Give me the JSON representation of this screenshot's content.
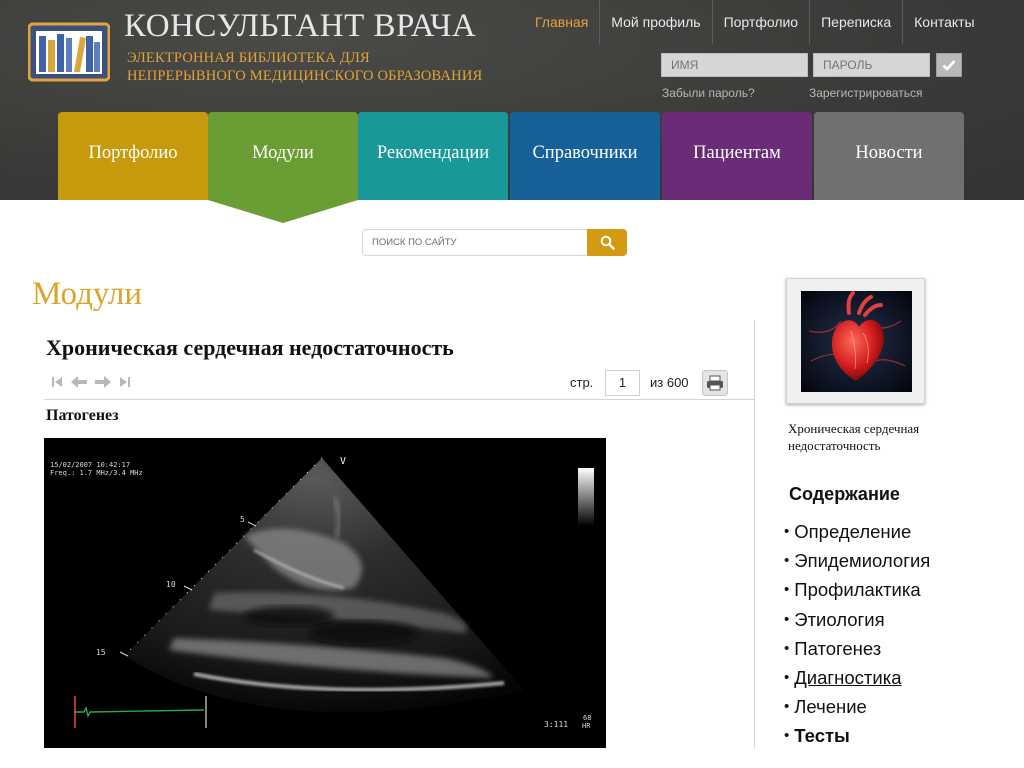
{
  "header": {
    "site_title": "КОНСУЛЬТАНТ ВРАЧА",
    "subtitle_line1": "ЭЛЕКТРОННАЯ БИБЛИОТЕКА ДЛЯ",
    "subtitle_line2": "НЕПРЕРЫВНОГО МЕДИЦИНСКОГО ОБРАЗОВАНИЯ",
    "logo_icon": "bookshelf-icon",
    "top_nav": [
      "Главная",
      "Мой профиль",
      "Портфолио",
      "Переписка",
      "Контакты"
    ],
    "active_top_nav": "Главная",
    "login": {
      "name_placeholder": "ИМЯ",
      "password_placeholder": "ПАРОЛЬ",
      "submit_icon": "checkmark-icon",
      "forgot_password": "Забыли пароль?",
      "register": "Зарегистрироваться"
    }
  },
  "main_tabs": [
    {
      "label": "Портфолио",
      "color": "#c79a0e"
    },
    {
      "label": "Модули",
      "color": "#6a9d34",
      "active": true
    },
    {
      "label": "Рекомендации",
      "color": "#19989a"
    },
    {
      "label": "Справочники",
      "color": "#16619a"
    },
    {
      "label": "Пациентам",
      "color": "#6a2c77"
    },
    {
      "label": "Новости",
      "color": "#707070"
    }
  ],
  "search": {
    "placeholder": "ПОИСК ПО САЙТУ",
    "button_icon": "search-icon",
    "button_color": "#d49a12"
  },
  "main": {
    "section_heading": "Модули",
    "article_title": "Хроническая сердечная недостаточность",
    "pager": {
      "page_label": "стр.",
      "current_page": "1",
      "total_label": "из 600",
      "nav_icons": [
        "first-page-icon",
        "prev-page-icon",
        "next-page-icon",
        "last-page-icon"
      ],
      "print_icon": "printer-icon"
    },
    "subsection_heading": "Патогенез",
    "image": {
      "kind": "echocardiogram",
      "overlay_line1": "15/02/2007 10:42:17",
      "overlay_line2": "Freq.: 1.7 MHz/3.4 MHz",
      "marker_v": "V",
      "depth_markers": [
        "5",
        "10",
        "15"
      ],
      "frame_counter": "3:111",
      "heart_rate_value": "68",
      "heart_rate_label": "HR"
    }
  },
  "sidebar": {
    "thumbnail_icon": "anatomical-heart-image",
    "module_caption": "Хроническая сердечная недостаточность",
    "contents_heading": "Содержание",
    "contents": [
      {
        "label": "Определение",
        "style": "normal"
      },
      {
        "label": "Эпидемиология",
        "style": "normal"
      },
      {
        "label": "Профилактика",
        "style": "normal"
      },
      {
        "label": "Этиология",
        "style": "normal"
      },
      {
        "label": "Патогенез",
        "style": "normal"
      },
      {
        "label": "Диагностика",
        "style": "link"
      },
      {
        "label": "Лечение",
        "style": "normal"
      },
      {
        "label": "Тесты",
        "style": "bold"
      }
    ]
  }
}
